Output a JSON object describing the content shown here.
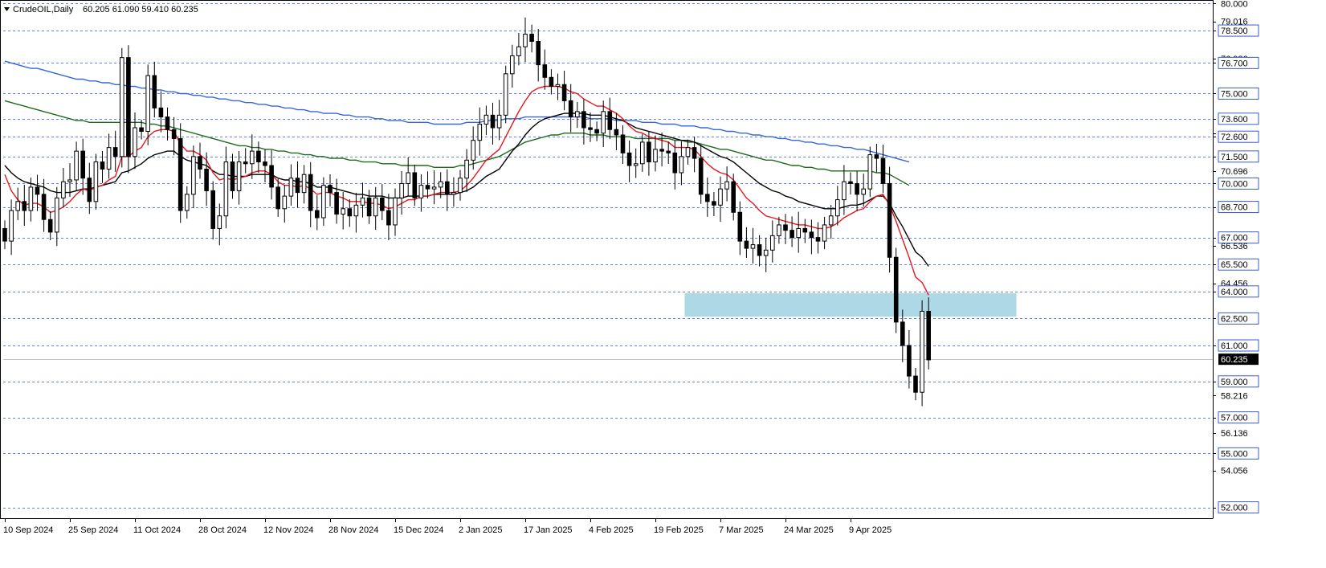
{
  "header": {
    "symbol": "CrudeOIL,Daily",
    "ohlc": "60.205 61.090 59.410 60.235"
  },
  "chart_data": {
    "type": "candlestick",
    "symbol": "CrudeOIL",
    "timeframe": "Daily",
    "ylim": [
      51.4,
      80.2
    ],
    "y_ticks": [
      "80.000",
      "79.016",
      "78.500",
      "76.936",
      "76.700",
      "75.000",
      "73.600",
      "72.776",
      "72.600",
      "71.500",
      "70.696",
      "70.000",
      "68.700",
      "67.000",
      "66.536",
      "65.500",
      "64.456",
      "64.000",
      "62.500",
      "61.000",
      "59.000",
      "58.216",
      "57.000",
      "56.136",
      "55.000",
      "54.056",
      "52.000"
    ],
    "support_resistance_levels": [
      80.0,
      78.5,
      76.7,
      75.0,
      73.6,
      72.6,
      71.5,
      70.0,
      68.7,
      67.0,
      65.5,
      64.0,
      62.5,
      61.0,
      59.0,
      57.0,
      55.0,
      52.0
    ],
    "highlighted_levels": [
      "78.500",
      "76.700",
      "75.000",
      "73.600",
      "72.600",
      "71.500",
      "70.000",
      "68.700",
      "67.000",
      "65.500",
      "64.000",
      "62.500",
      "61.000",
      "59.000",
      "57.000",
      "55.000",
      "52.000"
    ],
    "current_price": "60.235",
    "x_labels": [
      "10 Sep 2024",
      "25 Sep 2024",
      "11 Oct 2024",
      "28 Oct 2024",
      "12 Nov 2024",
      "28 Nov 2024",
      "15 Dec 2024",
      "2 Jan 2025",
      "17 Jan 2025",
      "4 Feb 2025",
      "19 Feb 2025",
      "7 Mar 2025",
      "24 Mar 2025",
      "9 Apr 2025"
    ],
    "x_label_index": [
      0,
      10,
      20,
      30,
      40,
      50,
      60,
      70,
      80,
      90,
      100,
      110,
      120,
      130
    ],
    "zone": {
      "from_index": 105,
      "to_index": 155,
      "low": 62.6,
      "high": 63.9,
      "color": "#add8e6"
    },
    "close": [
      66.8,
      68.5,
      69.0,
      68.5,
      69.8,
      69.4,
      68.0,
      67.3,
      69.2,
      70.1,
      70.2,
      71.8,
      70.3,
      69.0,
      71.2,
      70.8,
      72.0,
      71.5,
      77.0,
      71.5,
      73.1,
      72.9,
      76.0,
      74.2,
      73.7,
      73.0,
      72.5,
      68.5,
      69.4,
      71.5,
      70.8,
      69.6,
      67.5,
      68.2,
      71.2,
      69.6,
      71.2,
      71.1,
      71.8,
      71.2,
      71.0,
      69.8,
      68.6,
      69.3,
      70.3,
      69.5,
      70.5,
      68.5,
      68.1,
      69.9,
      69.5,
      68.3,
      68.6,
      68.2,
      68.8,
      69.2,
      68.2,
      69.2,
      68.5,
      67.7,
      69.2,
      70.0,
      70.6,
      69.2,
      69.9,
      69.7,
      69.8,
      70.1,
      69.4,
      69.5,
      70.3,
      71.3,
      72.4,
      73.3,
      73.8,
      73.1,
      73.8,
      76.1,
      77.1,
      77.6,
      78.3,
      77.9,
      76.6,
      75.9,
      75.4,
      75.5,
      74.6,
      73.7,
      74.0,
      73.1,
      73.0,
      72.8,
      74.0,
      73.0,
      72.7,
      71.7,
      71.0,
      71.1,
      72.3,
      71.2,
      71.9,
      71.8,
      71.7,
      70.6,
      71.5,
      72.0,
      71.4,
      69.4,
      69.0,
      68.8,
      69.7,
      70.1,
      68.4,
      66.8,
      66.4,
      66.6,
      66.0,
      66.3,
      67.1,
      67.7,
      67.4,
      67.0,
      67.5,
      67.3,
      67.0,
      66.8,
      67.7,
      68.2,
      69.1,
      70.1,
      70.0,
      69.4,
      69.7,
      71.6,
      71.4,
      70.0,
      65.9,
      62.3,
      61.0,
      59.3,
      58.4,
      62.9,
      60.2
    ],
    "open": [
      67.5,
      66.8,
      68.5,
      69.0,
      68.5,
      69.8,
      69.4,
      68.0,
      67.3,
      69.2,
      70.1,
      70.2,
      71.8,
      70.3,
      69.0,
      71.2,
      70.8,
      72.0,
      71.5,
      77.0,
      71.5,
      73.1,
      72.9,
      76.0,
      74.2,
      73.7,
      73.0,
      72.5,
      68.5,
      69.4,
      71.5,
      70.8,
      69.6,
      67.5,
      68.2,
      71.2,
      69.6,
      71.2,
      71.1,
      71.8,
      71.2,
      71.0,
      69.8,
      68.6,
      69.3,
      70.3,
      69.5,
      70.5,
      68.5,
      68.1,
      69.9,
      69.5,
      68.3,
      68.6,
      68.2,
      68.8,
      69.2,
      68.2,
      69.2,
      68.5,
      67.7,
      69.2,
      70.0,
      70.6,
      69.2,
      69.9,
      69.7,
      69.8,
      70.1,
      69.4,
      69.5,
      70.3,
      71.3,
      72.4,
      73.3,
      73.8,
      73.1,
      73.8,
      76.1,
      77.1,
      77.6,
      78.3,
      77.9,
      76.6,
      75.9,
      75.4,
      75.5,
      74.6,
      73.7,
      74.0,
      73.1,
      73.0,
      72.8,
      74.0,
      73.0,
      72.7,
      71.7,
      71.0,
      71.1,
      72.3,
      71.2,
      71.9,
      71.8,
      71.7,
      70.6,
      71.5,
      72.0,
      71.4,
      69.4,
      69.0,
      68.8,
      69.7,
      70.1,
      68.4,
      66.8,
      66.4,
      66.6,
      66.0,
      66.3,
      67.1,
      67.7,
      67.4,
      67.0,
      67.5,
      67.3,
      67.0,
      66.8,
      67.7,
      68.2,
      69.1,
      70.1,
      70.0,
      69.4,
      69.7,
      71.6,
      71.4,
      70.0,
      65.9,
      62.3,
      61.0,
      59.3,
      58.4,
      62.9
    ],
    "ema_red": [
      70.5,
      69.6,
      69.1,
      68.8,
      68.9,
      68.9,
      68.7,
      68.4,
      68.5,
      68.7,
      69.0,
      69.4,
      69.7,
      69.6,
      69.8,
      69.9,
      70.2,
      70.4,
      71.5,
      71.5,
      71.8,
      72.0,
      72.6,
      72.9,
      73.0,
      73.0,
      72.9,
      72.2,
      71.8,
      71.8,
      71.6,
      71.3,
      70.6,
      70.2,
      70.3,
      70.2,
      70.3,
      70.4,
      70.6,
      70.7,
      70.7,
      70.5,
      70.1,
      69.9,
      69.9,
      69.8,
      69.9,
      69.7,
      69.4,
      69.5,
      69.5,
      69.3,
      69.2,
      69.0,
      69.0,
      69.0,
      68.9,
      68.9,
      68.8,
      68.6,
      68.7,
      68.9,
      69.1,
      69.1,
      69.3,
      69.3,
      69.4,
      69.5,
      69.5,
      69.5,
      69.6,
      69.9,
      70.3,
      70.8,
      71.3,
      71.6,
      71.9,
      72.6,
      73.3,
      74.0,
      74.6,
      75.1,
      75.3,
      75.4,
      75.4,
      75.4,
      75.3,
      75.1,
      75.0,
      74.7,
      74.5,
      74.3,
      74.3,
      74.1,
      73.9,
      73.6,
      73.2,
      72.9,
      72.8,
      72.6,
      72.5,
      72.4,
      72.3,
      72.0,
      72.0,
      72.0,
      71.9,
      71.5,
      71.1,
      70.8,
      70.6,
      70.5,
      70.2,
      69.7,
      69.2,
      68.9,
      68.5,
      68.2,
      68.1,
      68.0,
      67.9,
      67.8,
      67.7,
      67.7,
      67.6,
      67.5,
      67.5,
      67.6,
      67.8,
      68.1,
      68.3,
      68.5,
      68.6,
      69.0,
      69.3,
      69.4,
      68.8,
      67.9,
      66.9,
      65.9,
      64.8,
      64.5,
      63.8
    ],
    "ema_black": [
      71.0,
      70.6,
      70.3,
      70.1,
      70.0,
      69.9,
      69.8,
      69.6,
      69.5,
      69.5,
      69.5,
      69.6,
      69.7,
      69.7,
      69.8,
      69.9,
      70.0,
      70.1,
      70.6,
      70.7,
      70.9,
      71.1,
      71.4,
      71.6,
      71.7,
      71.8,
      71.8,
      71.5,
      71.3,
      71.2,
      71.1,
      71.0,
      70.7,
      70.5,
      70.5,
      70.4,
      70.4,
      70.4,
      70.5,
      70.5,
      70.5,
      70.5,
      70.3,
      70.2,
      70.2,
      70.1,
      70.1,
      70.0,
      69.8,
      69.8,
      69.8,
      69.7,
      69.6,
      69.5,
      69.4,
      69.4,
      69.3,
      69.3,
      69.3,
      69.2,
      69.2,
      69.2,
      69.3,
      69.3,
      69.3,
      69.3,
      69.4,
      69.4,
      69.4,
      69.4,
      69.5,
      69.6,
      69.8,
      70.1,
      70.4,
      70.6,
      70.8,
      71.3,
      71.8,
      72.2,
      72.7,
      73.1,
      73.4,
      73.6,
      73.7,
      73.8,
      73.9,
      73.9,
      73.9,
      73.9,
      73.8,
      73.8,
      73.8,
      73.7,
      73.6,
      73.5,
      73.3,
      73.1,
      73.0,
      72.9,
      72.8,
      72.7,
      72.6,
      72.5,
      72.4,
      72.4,
      72.3,
      72.1,
      71.9,
      71.7,
      71.5,
      71.4,
      71.2,
      70.9,
      70.6,
      70.3,
      70.0,
      69.8,
      69.6,
      69.5,
      69.3,
      69.2,
      69.0,
      68.9,
      68.8,
      68.7,
      68.6,
      68.6,
      68.6,
      68.7,
      68.8,
      68.8,
      68.9,
      69.1,
      69.3,
      69.3,
      68.9,
      68.2,
      67.6,
      66.9,
      66.2,
      65.9,
      65.4
    ],
    "ma_green": [
      74.6,
      74.5,
      74.4,
      74.3,
      74.2,
      74.1,
      74.0,
      73.9,
      73.8,
      73.7,
      73.6,
      73.5,
      73.5,
      73.4,
      73.4,
      73.4,
      73.4,
      73.4,
      73.4,
      73.4,
      73.4,
      73.4,
      73.3,
      73.3,
      73.2,
      73.2,
      73.1,
      73.0,
      72.9,
      72.8,
      72.7,
      72.6,
      72.5,
      72.4,
      72.3,
      72.2,
      72.1,
      72.1,
      72.0,
      72.0,
      71.9,
      71.9,
      71.8,
      71.8,
      71.7,
      71.7,
      71.6,
      71.6,
      71.5,
      71.5,
      71.4,
      71.4,
      71.4,
      71.3,
      71.3,
      71.2,
      71.2,
      71.2,
      71.1,
      71.1,
      71.1,
      71.0,
      71.0,
      71.0,
      71.0,
      71.0,
      70.9,
      70.9,
      70.9,
      70.9,
      71.0,
      71.0,
      71.1,
      71.2,
      71.3,
      71.4,
      71.5,
      71.7,
      71.9,
      72.1,
      72.3,
      72.4,
      72.5,
      72.6,
      72.7,
      72.7,
      72.8,
      72.8,
      72.8,
      72.8,
      72.7,
      72.7,
      72.7,
      72.6,
      72.6,
      72.6,
      72.6,
      72.5,
      72.5,
      72.5,
      72.5,
      72.5,
      72.5,
      72.4,
      72.4,
      72.3,
      72.3,
      72.2,
      72.1,
      72.0,
      71.9,
      71.9,
      71.8,
      71.7,
      71.6,
      71.5,
      71.4,
      71.3,
      71.3,
      71.2,
      71.1,
      71.0,
      71.0,
      70.9,
      70.9,
      70.8,
      70.8,
      70.7,
      70.7,
      70.7,
      70.7,
      70.7,
      70.7,
      70.7,
      70.6,
      70.6,
      70.5,
      70.3,
      70.1,
      69.9
    ],
    "ma_blue": [
      76.8,
      76.7,
      76.6,
      76.5,
      76.4,
      76.4,
      76.3,
      76.2,
      76.1,
      76.0,
      75.9,
      75.8,
      75.8,
      75.7,
      75.7,
      75.6,
      75.6,
      75.5,
      75.5,
      75.4,
      75.4,
      75.3,
      75.3,
      75.2,
      75.2,
      75.1,
      75.1,
      75.0,
      75.0,
      74.9,
      74.9,
      74.8,
      74.8,
      74.7,
      74.7,
      74.6,
      74.6,
      74.5,
      74.5,
      74.4,
      74.4,
      74.3,
      74.3,
      74.2,
      74.2,
      74.1,
      74.1,
      74.0,
      74.0,
      73.9,
      73.9,
      73.9,
      73.8,
      73.8,
      73.7,
      73.7,
      73.7,
      73.6,
      73.6,
      73.5,
      73.5,
      73.5,
      73.4,
      73.4,
      73.4,
      73.4,
      73.3,
      73.3,
      73.3,
      73.3,
      73.3,
      73.4,
      73.4,
      73.4,
      73.5,
      73.5,
      73.5,
      73.6,
      73.6,
      73.6,
      73.7,
      73.7,
      73.7,
      73.7,
      73.7,
      73.7,
      73.7,
      73.7,
      73.7,
      73.7,
      73.6,
      73.6,
      73.6,
      73.6,
      73.5,
      73.5,
      73.5,
      73.5,
      73.4,
      73.4,
      73.4,
      73.3,
      73.3,
      73.3,
      73.2,
      73.2,
      73.2,
      73.1,
      73.1,
      73.0,
      73.0,
      72.9,
      72.9,
      72.8,
      72.8,
      72.7,
      72.7,
      72.6,
      72.6,
      72.5,
      72.5,
      72.4,
      72.4,
      72.3,
      72.3,
      72.2,
      72.2,
      72.1,
      72.1,
      72.0,
      72.0,
      71.9,
      71.9,
      71.8,
      71.7,
      71.6,
      71.5,
      71.4,
      71.3,
      71.2
    ]
  }
}
